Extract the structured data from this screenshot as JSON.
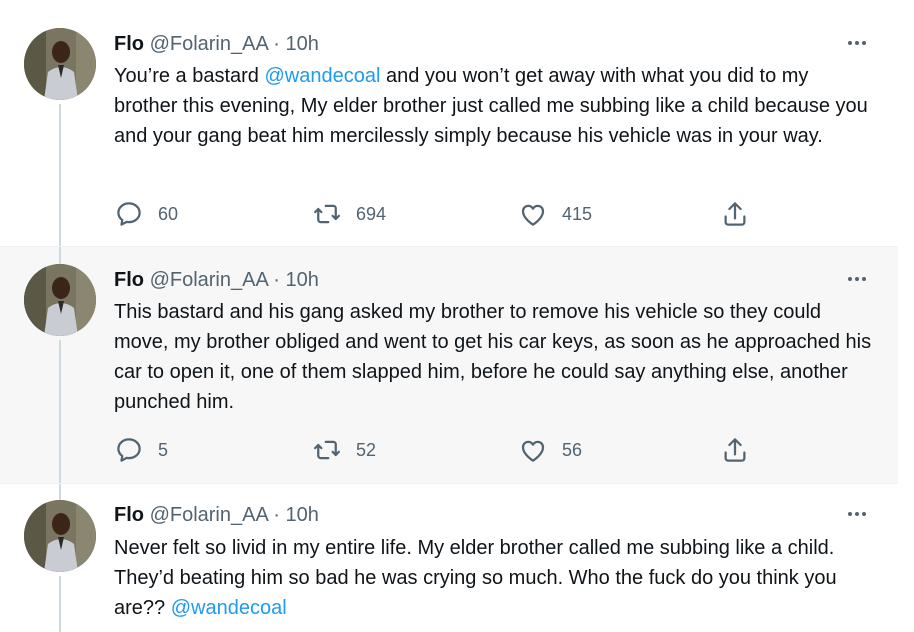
{
  "tweets": [
    {
      "name": "Flo",
      "handle": "@Folarin_AA",
      "separator": "·",
      "time": "10h",
      "text_before": "You’re a bastard ",
      "mention": "@wandecoal",
      "text_after": " and you won’t get away with what you did to my brother this evening, My elder brother just called me subbing like a child because you and your gang beat him mercilessly simply because his vehicle was in your way.",
      "replies": "60",
      "retweets": "694",
      "likes": "415"
    },
    {
      "name": "Flo",
      "handle": "@Folarin_AA",
      "separator": "·",
      "time": "10h",
      "text_before": "This bastard and his gang asked my brother to remove his vehicle so they could move, my brother obliged and went to get his car keys, as soon as he approached his car to open it, one of them slapped him, before he could say anything else, another punched him.",
      "mention": "",
      "text_after": "",
      "replies": "5",
      "retweets": "52",
      "likes": "56"
    },
    {
      "name": "Flo",
      "handle": "@Folarin_AA",
      "separator": "·",
      "time": "10h",
      "text_before": "Never felt so livid in my entire life. My elder brother called me subbing like a child. They’d beating him so bad he was crying so much. Who the fuck do you think you are?? ",
      "mention": "@wandecoal",
      "text_after": "",
      "replies": "",
      "retweets": "",
      "likes": ""
    }
  ],
  "colors": {
    "accent": "#1d9bf0",
    "secondary_text": "#536471",
    "highlight_bg": "#f7f7f7"
  },
  "icons": [
    "more-icon",
    "reply-icon",
    "retweet-icon",
    "like-icon",
    "share-icon"
  ]
}
